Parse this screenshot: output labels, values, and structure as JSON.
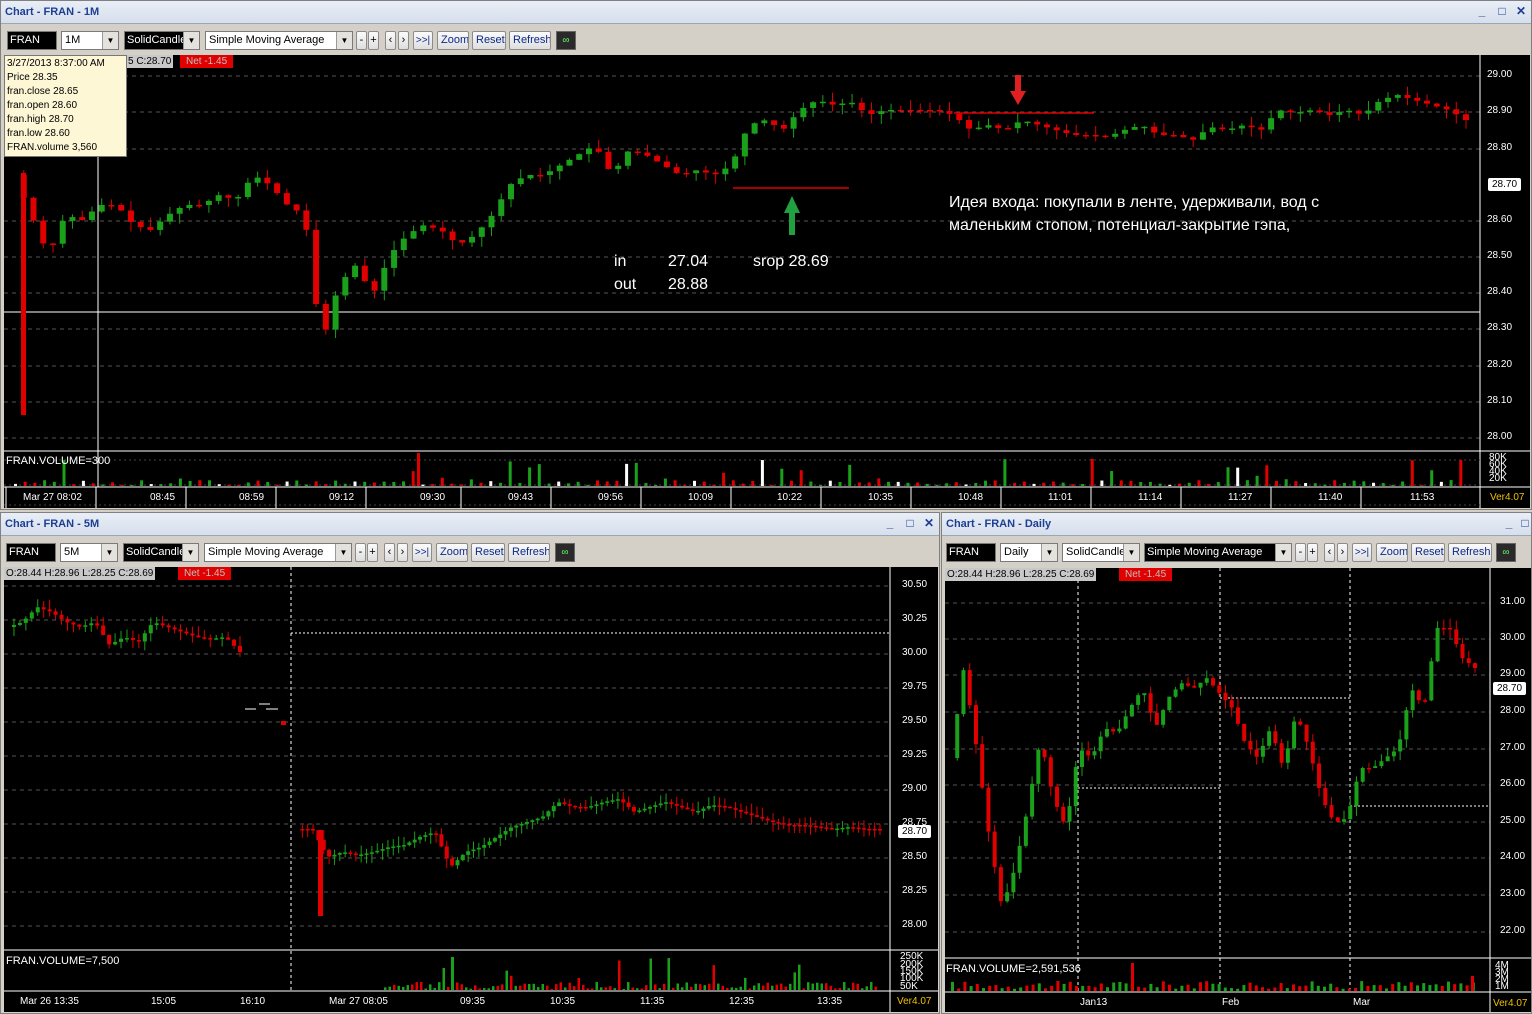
{
  "win1": {
    "title": "Chart - FRAN - 1M",
    "symbol": "FRAN",
    "interval": "1M",
    "style": "SolidCandle",
    "indicator": "Simple Moving Average",
    "btn_minus": "-",
    "btn_plus": "+",
    "btn_prev": "‹",
    "btn_next": "›",
    "btn_end": ">>|",
    "zoom": "Zoom",
    "reset": "Reset",
    "refresh": "Refresh",
    "info_close": "5  C:28.70",
    "net": "Net -1.45",
    "tooltip": [
      "3/27/2013 8:37:00 AM",
      "Price  28.35",
      "fran.close  28.65",
      "fran.open  28.60",
      "fran.high  28.70",
      "fran.low  28.60",
      "FRAN.volume  3,560"
    ],
    "price_labels": [
      "29.00",
      "28.90",
      "28.80",
      "28.60",
      "28.50",
      "28.40",
      "28.30",
      "28.20",
      "28.10",
      "28.00"
    ],
    "current_price": "28.70",
    "volume_label": "FRAN.VOLUME=300",
    "volume_scale": [
      "80K",
      "60K",
      "40K",
      "20K"
    ],
    "time_labels": [
      "Mar 27 08:02",
      "08:45",
      "08:59",
      "09:12",
      "09:30",
      "09:43",
      "09:56",
      "10:09",
      "10:22",
      "10:35",
      "10:48",
      "11:01",
      "11:14",
      "11:27",
      "11:40",
      "11:53"
    ],
    "version": "Ver4.07",
    "annotation_idea_1": "Идея входа: покупали в ленте,  удерживали, вод с",
    "annotation_idea_2": "маленьким стопом, потенциал-закрытие гэпа,",
    "annotation_in": "in",
    "annotation_in_val": "27.04",
    "annotation_out": "out",
    "annotation_out_val": "28.88",
    "annotation_stop": "srop  28.69",
    "colors": {
      "up": "#1aa01a",
      "down": "#e00000",
      "grid": "#555555",
      "stopline": "#e00000",
      "arrow_down": "#e02020",
      "arrow_up": "#20a040"
    }
  },
  "win2": {
    "title": "Chart - FRAN - 5M",
    "symbol": "FRAN",
    "interval": "5M",
    "style": "SolidCandle",
    "indicator": "Simple Moving Average",
    "zoom": "Zoom",
    "reset": "Reset",
    "refresh": "Refresh",
    "info": "O:28.44  H:28.96  L:28.25  C:28.69",
    "net": "Net -1.45",
    "price_labels": [
      "30.50",
      "30.25",
      "30.00",
      "29.75",
      "29.50",
      "29.25",
      "29.00",
      "28.75",
      "28.50",
      "28.25",
      "28.00"
    ],
    "current_price": "28.70",
    "volume_label": "FRAN.VOLUME=7,500",
    "volume_scale": [
      "250K",
      "200K",
      "150K",
      "100K",
      "50K"
    ],
    "time_labels": [
      "Mar 26 13:35",
      "15:05",
      "16:10",
      "Mar 27 08:05",
      "09:35",
      "10:35",
      "11:35",
      "12:35",
      "13:35"
    ],
    "version": "Ver4.07"
  },
  "win3": {
    "title": "Chart - FRAN - Daily",
    "symbol": "FRAN",
    "interval": "Daily",
    "style": "SolidCandle",
    "indicator": "Simple Moving Average",
    "zoom": "Zoom",
    "reset": "Reset",
    "refresh": "Refresh",
    "info": "O:28.44  H:28.96  L:28.25  C:28.69",
    "net": "Net -1.45",
    "price_labels": [
      "31.00",
      "30.00",
      "29.00",
      "28.00",
      "27.00",
      "26.00",
      "25.00",
      "24.00",
      "23.00",
      "22.00"
    ],
    "current_price": "28.70",
    "volume_label": "FRAN.VOLUME=2,591,536",
    "volume_scale": [
      "4M",
      "3M",
      "2M",
      "1M"
    ],
    "time_labels": [
      "Jan13",
      "Feb",
      "Mar"
    ],
    "version": "Ver4.07"
  }
}
